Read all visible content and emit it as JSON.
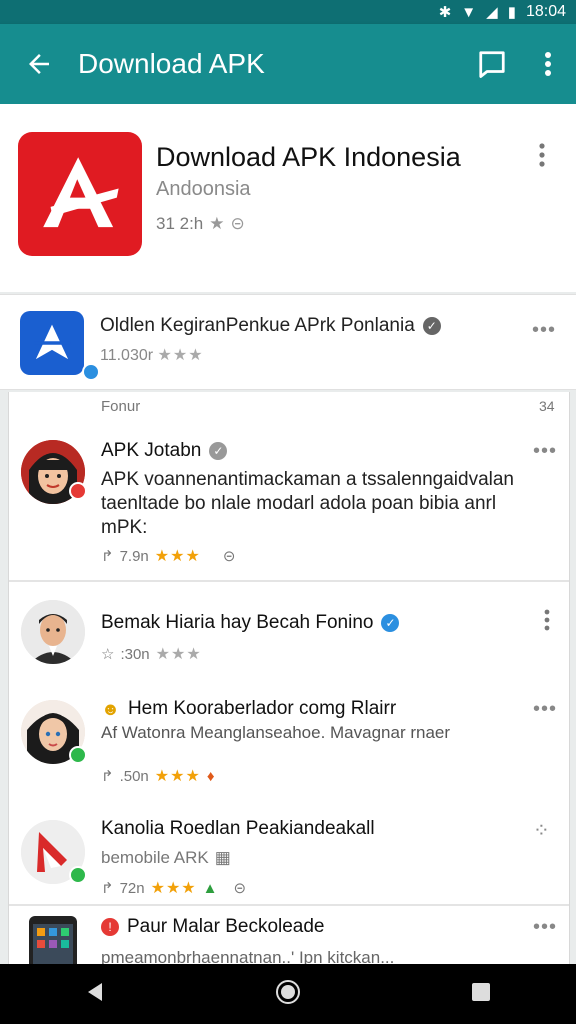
{
  "status": {
    "time": "18:04"
  },
  "appbar": {
    "title": "Download APK"
  },
  "hero": {
    "title": "Download APK Indonesia",
    "subtitle": "Andoonsia",
    "meta": "31 2:h",
    "icon_color": "#e01b22"
  },
  "row2": {
    "name": "Oldlen KegiranPenkue APrk Ponlania",
    "meta": "11.030r"
  },
  "feed": {
    "header": "Fonur",
    "count": "34",
    "posts": [
      {
        "name": "APK Jotabn",
        "text": "APK voannenantimackaman a tssalenngaidvalan taenltade bo nlale modarl adola poan bibia anrl mPK:",
        "meta": "7.9n"
      },
      {
        "name": "Bemak Hiaria hay Becah Fonino",
        "meta": ":30n"
      },
      {
        "name": "Hem Kooraberlador comg Rlairr",
        "text": "Af Watonra Meanglanseahoe. Mavagnar rnaer",
        "meta": ".50n"
      },
      {
        "name": "Kanolia Roedlan Peakiandeakall",
        "sub": "bemobile ARK",
        "meta": "72n"
      },
      {
        "name": "Paur Malar Beckoleade",
        "text": "pmeamonbrhaennatnan..' Ipn kitckan..."
      }
    ]
  },
  "colors": {
    "appbar": "#168d8f",
    "statusbar": "#0e6f73",
    "verified": "#2b8fe0",
    "star": "#f2a10a"
  }
}
